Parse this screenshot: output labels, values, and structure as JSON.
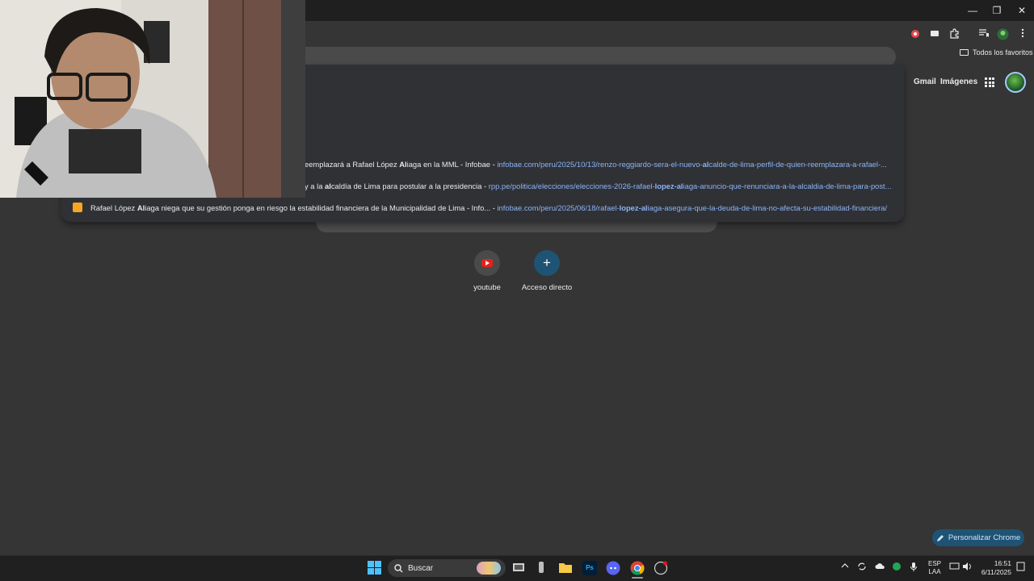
{
  "window": {
    "controls": [
      "—",
      "❐",
      "✕"
    ]
  },
  "bookmarks": {
    "all_bookmarks_label": "Todos los favoritos"
  },
  "google_header": {
    "gmail_label": "Gmail",
    "images_label": "Imágenes"
  },
  "omnibox": {
    "suggestions": [
      {
        "title_pre": "eemplazará a Rafael López ",
        "title_bold": "Al",
        "title_post": "iaga en la MML - Infobae",
        "url_pre": "infobae.com/peru/2025/10/13/renzo-reggiardo-sera-el-nuevo-",
        "url_bold": "al",
        "url_post": "calde-de-lima-perfil-de-quien-reemplazara-a-rafael-..."
      },
      {
        "title_pre": "y a la ",
        "title_bold": "al",
        "title_post": "caldía de Lima para postular a la presidencia",
        "url_pre": "rpp.pe/politica/elecciones/elecciones-2026-rafael-",
        "url_bold": "lopez-al",
        "url_post": "iaga-anuncio-que-renunciara-a-la-alcaldia-de-lima-para-post..."
      },
      {
        "title_pre": "Rafael López ",
        "title_bold": "Al",
        "title_post": "iaga niega que su gestión ponga en riesgo la estabilidad financiera de la Municipalidad de Lima - Info...",
        "url_pre": "infobae.com/peru/2025/06/18/rafael-",
        "url_bold": "lopez-al",
        "url_post": "iaga-asegura-que-la-deuda-de-lima-no-afecta-su-estabilidad-financiera/"
      }
    ],
    "separator": " - "
  },
  "shortcuts": [
    {
      "label": "youtube",
      "icon": "youtube-icon"
    },
    {
      "label": "Acceso directo",
      "icon": "plus-icon"
    }
  ],
  "customize_button": {
    "label": "Personalizar Chrome",
    "icon": "pencil-icon"
  },
  "taskbar": {
    "search_placeholder": "Buscar",
    "language_line1": "ESP",
    "language_line2": "LAA",
    "time": "16:51",
    "date": "6/11/2025",
    "apps": [
      "start-icon",
      "search-icon",
      "task-view-icon",
      "app-icon",
      "file-explorer-icon",
      "photoshop-icon",
      "discord-icon",
      "chrome-icon",
      "obs-icon"
    ],
    "photoshop_label": "Ps"
  },
  "colors": {
    "background": "#353535",
    "dropdown": "#303134",
    "link": "#8ab4f8",
    "accent_button": "#1f5373"
  }
}
